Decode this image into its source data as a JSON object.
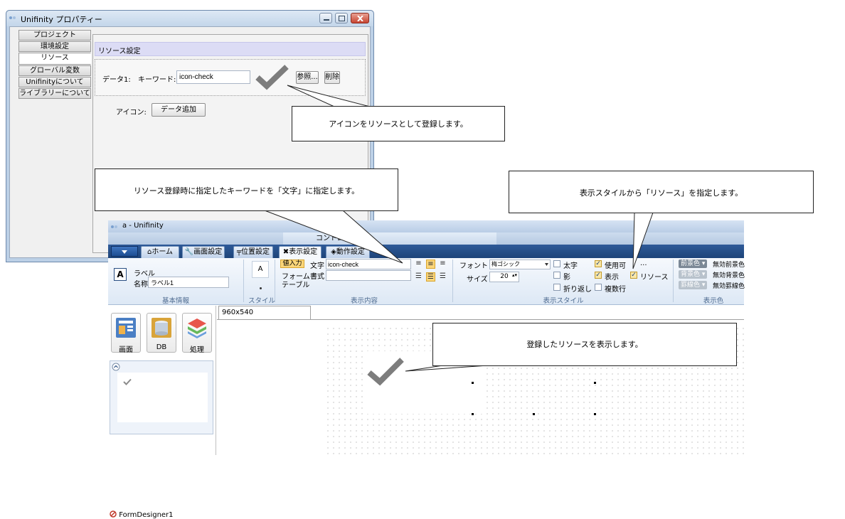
{
  "properties_window": {
    "title": "Unifinity プロパティー",
    "tabs": [
      "プロジェクト",
      "環境設定",
      "リソース",
      "グローバル変数",
      "Unifinityについて",
      "ライブラリーについて"
    ],
    "selected_tab": "リソース",
    "section_header": "リソース設定",
    "data_label": "データ1:",
    "keyword_label": "キーワード:",
    "keyword_value": "icon-check",
    "browse_button": "参照...",
    "delete_button": "削除",
    "icon_label": "アイコン:",
    "add_data_button": "データ追加"
  },
  "callouts": {
    "register_icon": "アイコンをリソースとして登録します。",
    "keyword_to_text": "リソース登録時に指定したキーワードを「文字」に指定します。",
    "style_resource": "表示スタイルから「リソース」を指定します。",
    "show_resource": "登録したリソースを表示します。"
  },
  "designer_window": {
    "title": "a - Unifinity",
    "context_tab": "コントロール",
    "tabs": [
      "ホーム",
      "画面設定",
      "位置設定",
      "表示設定",
      "動作設定"
    ],
    "selected_tab": "表示設定",
    "basic_info": {
      "type_label": "ラベル",
      "name_label": "名称",
      "name_value": "ラベル1",
      "group_label": "基本情報"
    },
    "style_group": {
      "icon_text": "A",
      "group_label": "スタイル"
    },
    "display_content": {
      "value_input_button": "値入力",
      "text_label": "文字",
      "text_value": "icon-check",
      "form_label": "フォーム",
      "format_label": "書式",
      "table_label": "テーブル",
      "group_label": "表示内容"
    },
    "display_style": {
      "font_label": "フォント",
      "font_value": "梅ゴシック",
      "size_label": "サイズ",
      "size_value": "20",
      "bold_label": "太字",
      "shadow_label": "影",
      "wrap_label": "折り返し",
      "enabled_label": "使用可",
      "visible_label": "表示",
      "multiline_label": "複数行",
      "more_label": "...",
      "resource_label": "リソース",
      "group_label": "表示スタイル"
    },
    "display_color": {
      "fg_color": "前景色",
      "bg_color": "背景色",
      "border_color": "罫線色",
      "fg_disabled": "無効前景色",
      "bg_disabled": "無効背景色",
      "border_disabled": "無効罫線色",
      "group_label": "表示色"
    },
    "tools": [
      "画面",
      "DB",
      "処理"
    ],
    "form_designer": "FormDesigner1",
    "canvas_tab": "960x540"
  }
}
